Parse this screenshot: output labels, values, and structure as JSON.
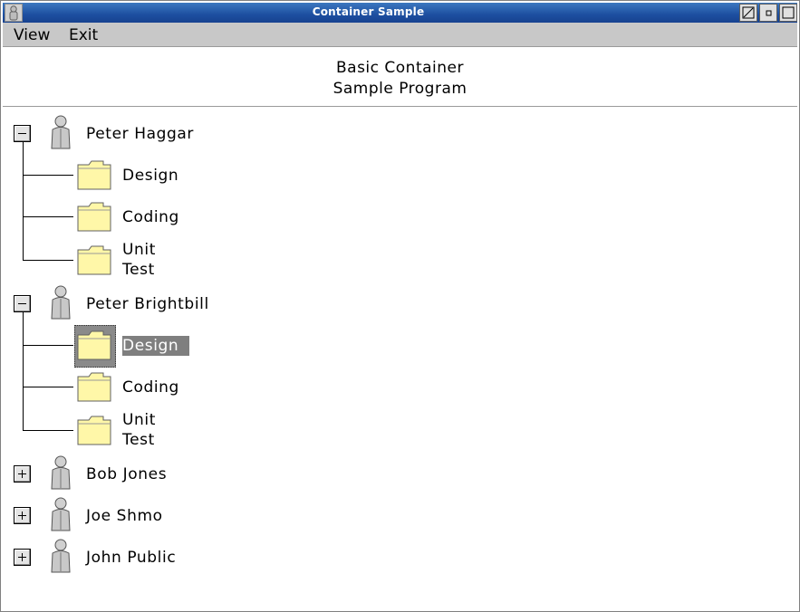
{
  "window": {
    "title": "Container Sample"
  },
  "menu": {
    "items": [
      "View",
      "Exit"
    ]
  },
  "heading": {
    "line1": "Basic Container",
    "line2": "Sample Program"
  },
  "tree": {
    "nodes": [
      {
        "label": "Peter Haggar",
        "expanded": true,
        "children": [
          {
            "label": "Design"
          },
          {
            "label": "Coding"
          },
          {
            "label_line1": "Unit",
            "label_line2": "Test"
          }
        ]
      },
      {
        "label": "Peter Brightbill",
        "expanded": true,
        "children": [
          {
            "label": "Design",
            "selected": true
          },
          {
            "label": "Coding"
          },
          {
            "label_line1": "Unit",
            "label_line2": "Test"
          }
        ]
      },
      {
        "label": "Bob Jones",
        "expanded": false
      },
      {
        "label": "Joe Shmo",
        "expanded": false
      },
      {
        "label": "John Public",
        "expanded": false
      }
    ]
  },
  "colors": {
    "titlebar": "#1d4fa0",
    "folder": "#fff7a8",
    "selection": "#7f7f7f"
  }
}
